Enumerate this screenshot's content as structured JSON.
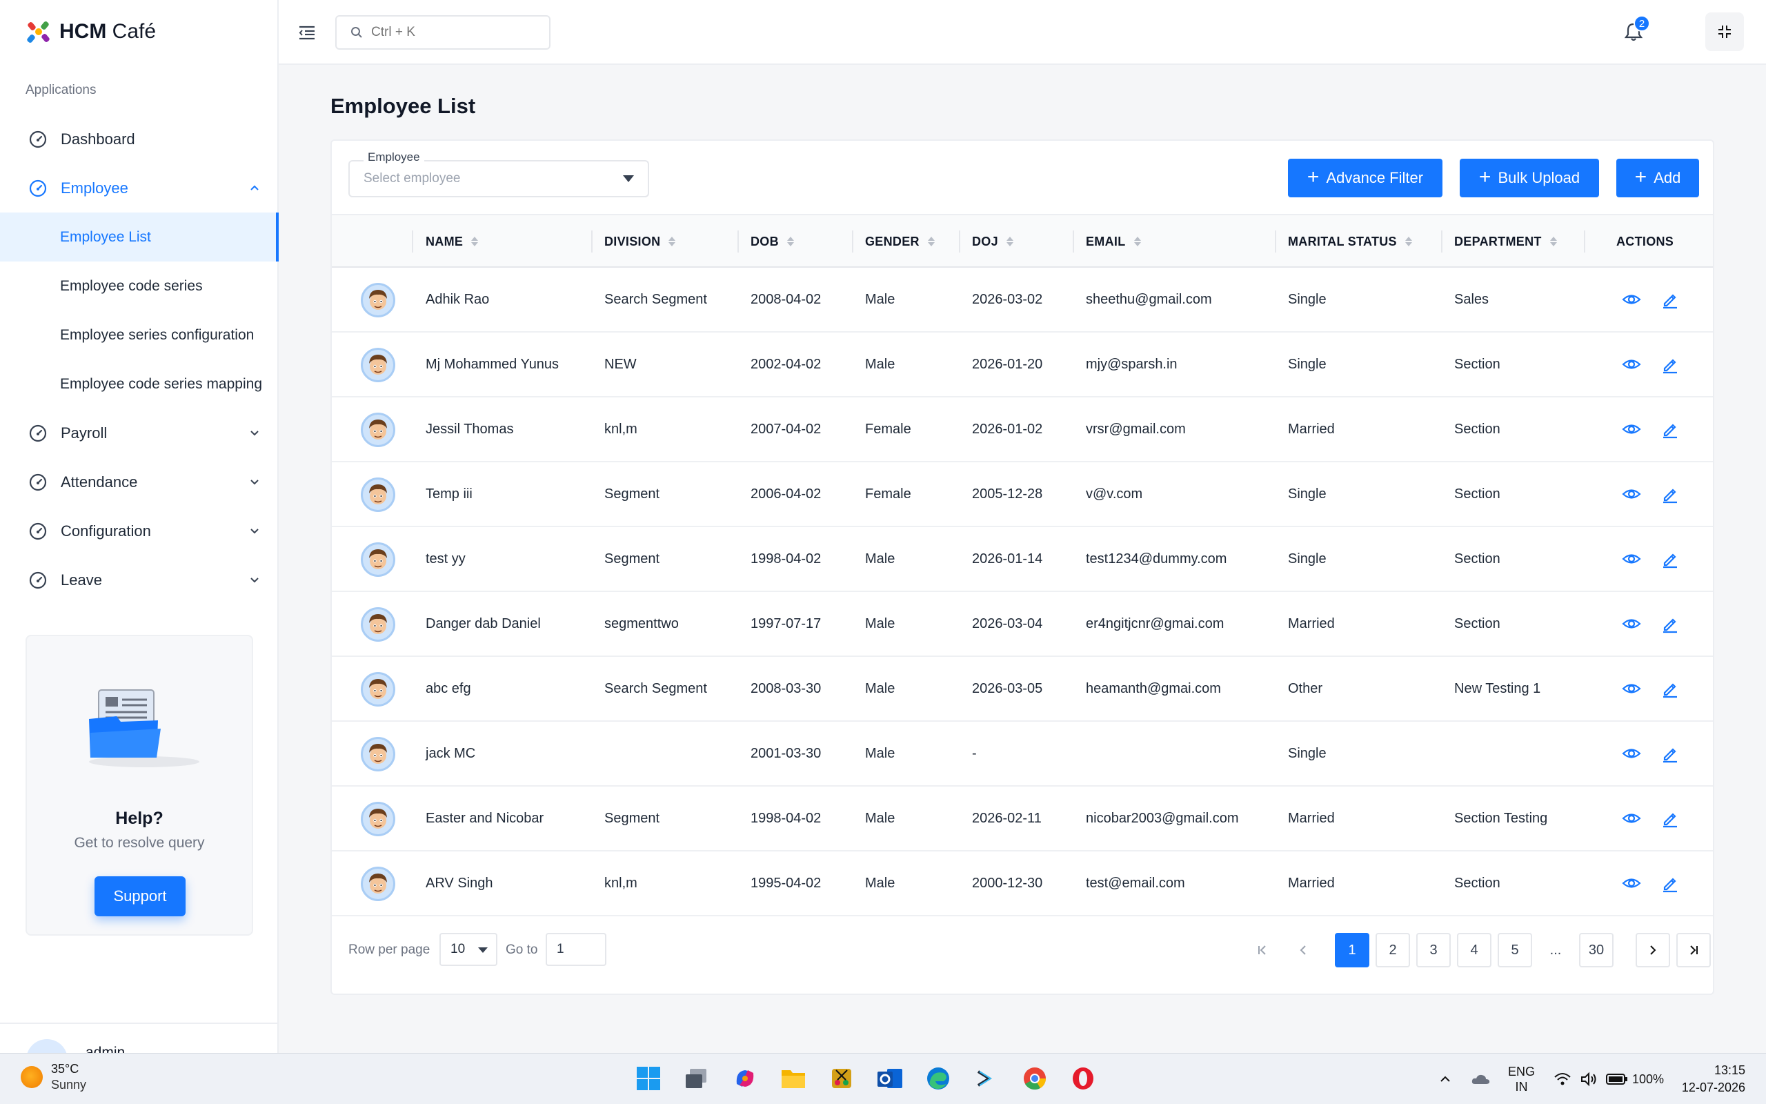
{
  "app": {
    "brand_bold": "HCM",
    "brand_rest": " Café"
  },
  "sidebar": {
    "section_label": "Applications",
    "items": [
      {
        "label": "Dashboard"
      },
      {
        "label": "Employee",
        "open": true,
        "children": [
          "Employee List",
          "Employee code series",
          "Employee series configuration",
          "Employee code series mapping"
        ]
      },
      {
        "label": "Payroll"
      },
      {
        "label": "Attendance"
      },
      {
        "label": "Configuration"
      },
      {
        "label": "Leave"
      }
    ],
    "active_child": "Employee List",
    "help": {
      "title": "Help?",
      "subtitle": "Get to resolve query",
      "button": "Support"
    },
    "user_name": "admin"
  },
  "topbar": {
    "search_placeholder": "Ctrl + K",
    "notification_count": "2"
  },
  "page": {
    "title": "Employee List",
    "filter_label": "Employee",
    "filter_placeholder": "Select employee",
    "buttons": {
      "advance_filter": "Advance Filter",
      "bulk_upload": "Bulk Upload",
      "add": "Add"
    }
  },
  "table": {
    "columns": [
      "NAME",
      "DIVISION",
      "DOB",
      "GENDER",
      "DOJ",
      "EMAIL",
      "MARITAL STATUS",
      "DEPARTMENT",
      "ACTIONS"
    ],
    "rows": [
      {
        "name": "Adhik Rao",
        "division": "Search Segment",
        "dob": "2008-04-02",
        "gender": "Male",
        "doj": "2026-03-02",
        "email": "sheethu@gmail.com",
        "marital": "Single",
        "department": "Sales"
      },
      {
        "name": "Mj Mohammed Yunus",
        "division": "NEW",
        "dob": "2002-04-02",
        "gender": "Male",
        "doj": "2026-01-20",
        "email": "mjy@sparsh.in",
        "marital": "Single",
        "department": "Section"
      },
      {
        "name": "Jessil Thomas",
        "division": "knl,m",
        "dob": "2007-04-02",
        "gender": "Female",
        "doj": "2026-01-02",
        "email": "vrsr@gmail.com",
        "marital": "Married",
        "department": "Section"
      },
      {
        "name": "Temp iii",
        "division": "Segment",
        "dob": "2006-04-02",
        "gender": "Female",
        "doj": "2005-12-28",
        "email": "v@v.com",
        "marital": "Single",
        "department": "Section"
      },
      {
        "name": "test yy",
        "division": "Segment",
        "dob": "1998-04-02",
        "gender": "Male",
        "doj": "2026-01-14",
        "email": "test1234@dummy.com",
        "marital": "Single",
        "department": "Section"
      },
      {
        "name": "Danger dab Daniel",
        "division": "segmenttwo",
        "dob": "1997-07-17",
        "gender": "Male",
        "doj": "2026-03-04",
        "email": "er4ngitjcnr@gmai.com",
        "marital": "Married",
        "department": "Section"
      },
      {
        "name": "abc efg",
        "division": "Search Segment",
        "dob": "2008-03-30",
        "gender": "Male",
        "doj": "2026-03-05",
        "email": "heamanth@gmai.com",
        "marital": "Other",
        "department": "New Testing 1"
      },
      {
        "name": "jack MC",
        "division": "",
        "dob": "2001-03-30",
        "gender": "Male",
        "doj": "-",
        "email": "",
        "marital": "Single",
        "department": ""
      },
      {
        "name": "Easter and Nicobar",
        "division": "Segment",
        "dob": "1998-04-02",
        "gender": "Male",
        "doj": "2026-02-11",
        "email": "nicobar2003@gmail.com",
        "marital": "Married",
        "department": "Section Testing"
      },
      {
        "name": "ARV Singh",
        "division": "knl,m",
        "dob": "1995-04-02",
        "gender": "Male",
        "doj": "2000-12-30",
        "email": "test@email.com",
        "marital": "Married",
        "department": "Section"
      }
    ]
  },
  "pagination": {
    "rows_label": "Row per page",
    "rows_value": "10",
    "goto_label": "Go to",
    "goto_value": "1",
    "pages": [
      "1",
      "2",
      "3",
      "4",
      "5",
      "...",
      "30"
    ],
    "current": "1"
  },
  "taskbar": {
    "weather_temp": "35°C",
    "weather_cond": "Sunny",
    "lang_top": "ENG",
    "lang_bottom": "IN",
    "battery": "100%",
    "time": "13:15",
    "date": "12-07-2026"
  },
  "colors": {
    "accent": "#1677ff",
    "active_bg": "#e8f3ff"
  }
}
